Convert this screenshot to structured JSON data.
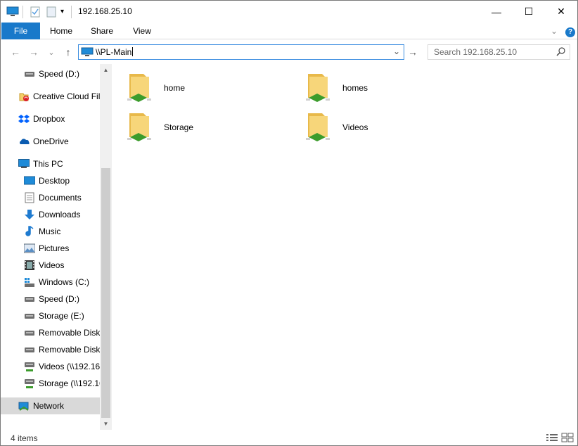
{
  "window": {
    "title": "192.168.25.10",
    "minimize": "—",
    "maximize": "☐",
    "close": "✕"
  },
  "quick_access": {
    "pc_icon": "computer-icon",
    "properties_icon": "checkmark-document-icon",
    "new_folder_icon": "blank-document-icon",
    "customize_arrow": "▾"
  },
  "ribbon": {
    "tabs": [
      {
        "label": "File"
      },
      {
        "label": "Home"
      },
      {
        "label": "Share"
      },
      {
        "label": "View"
      }
    ],
    "expand_glyph": "⌄",
    "help_glyph": "?"
  },
  "navigation": {
    "back_glyph": "←",
    "forward_glyph": "→",
    "recent_glyph": "⌄",
    "up_glyph": "↑",
    "address_value": "\\\\PL-Main",
    "dropdown_glyph": "⌄",
    "go_glyph": "→",
    "search_placeholder": "Search 192.168.25.10",
    "search_glyph": "⚲"
  },
  "nav_pane": {
    "items": [
      {
        "label": "Speed (D:)",
        "icon": "drive-icon"
      },
      {
        "label": "Creative Cloud Fil",
        "icon": "creative-cloud-icon"
      },
      {
        "label": "Dropbox",
        "icon": "dropbox-icon"
      },
      {
        "label": "OneDrive",
        "icon": "onedrive-icon"
      },
      {
        "label": "This PC",
        "icon": "computer-icon"
      },
      {
        "label": "Desktop",
        "icon": "desktop-icon"
      },
      {
        "label": "Documents",
        "icon": "documents-icon"
      },
      {
        "label": "Downloads",
        "icon": "downloads-icon"
      },
      {
        "label": "Music",
        "icon": "music-icon"
      },
      {
        "label": "Pictures",
        "icon": "pictures-icon"
      },
      {
        "label": "Videos",
        "icon": "videos-icon"
      },
      {
        "label": "Windows (C:)",
        "icon": "windows-drive-icon"
      },
      {
        "label": "Speed (D:)",
        "icon": "drive-icon"
      },
      {
        "label": "Storage (E:)",
        "icon": "drive-icon"
      },
      {
        "label": "Removable Disk",
        "icon": "drive-icon"
      },
      {
        "label": "Removable Disk",
        "icon": "drive-icon"
      },
      {
        "label": "Videos (\\\\192.16",
        "icon": "network-drive-icon"
      },
      {
        "label": "Storage (\\\\192.16",
        "icon": "network-drive-icon"
      },
      {
        "label": "Network",
        "icon": "network-icon"
      }
    ],
    "scroll_up": "▲",
    "scroll_down": "▼"
  },
  "content": {
    "folders": [
      {
        "label": "home",
        "icon": "shared-folder-icon"
      },
      {
        "label": "homes",
        "icon": "shared-folder-icon"
      },
      {
        "label": "Storage",
        "icon": "shared-folder-icon"
      },
      {
        "label": "Videos",
        "icon": "shared-folder-icon"
      }
    ]
  },
  "status": {
    "item_count": "4 items",
    "details_view_icon": "details-view-icon",
    "large_icons_view_icon": "large-icons-view-icon"
  },
  "colors": {
    "accent": "#1979ca",
    "selection": "#d9d9d9",
    "folder": "#f5cf6a",
    "share_green": "#3c9c2c"
  }
}
